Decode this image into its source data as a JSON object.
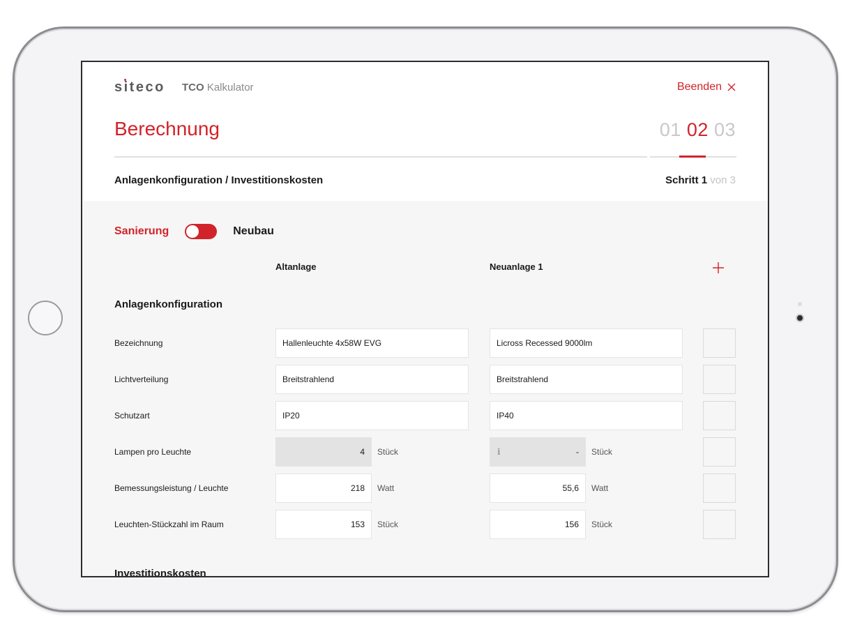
{
  "colors": {
    "accent": "#d2232a"
  },
  "header": {
    "logo": "siteco",
    "app_name_bold": "TCO",
    "app_name_rest": " Kalkulator",
    "exit_label": "Beenden",
    "title": "Berechnung",
    "steps": [
      "01",
      "02",
      "03"
    ],
    "active_step": "02",
    "subtitle": "Anlagenkonfiguration / Investitionskosten",
    "step_label": "Schritt 1",
    "step_of": "von 3"
  },
  "toggle": {
    "left_label": "Sanierung",
    "right_label": "Neubau",
    "state": "Sanierung"
  },
  "columns": {
    "old": "Altanlage",
    "new": "Neuanlage 1",
    "add_icon": "plus-icon"
  },
  "sections": {
    "config": "Anlagenkonfiguration",
    "invest": "Investitionskosten"
  },
  "rows": [
    {
      "label": "Bezeichnung",
      "old": "Hallenleuchte 4x58W EVG",
      "new": "Licross Recessed 9000lm"
    },
    {
      "label": "Lichtverteilung",
      "old": "Breitstrahlend",
      "new": "Breitstrahlend"
    },
    {
      "label": "Schutzart",
      "old": "IP20",
      "new": "IP40"
    },
    {
      "label": "Lampen pro Leuchte",
      "old": "4",
      "new": "-",
      "unit": "Stück",
      "new_info_icon": "info-icon"
    },
    {
      "label": "Bemessungsleistung / Leuchte",
      "old": "218",
      "new": "55,6",
      "unit": "Watt"
    },
    {
      "label": "Leuchten-Stückzahl im Raum",
      "old": "153",
      "new": "156",
      "unit": "Stück"
    }
  ]
}
